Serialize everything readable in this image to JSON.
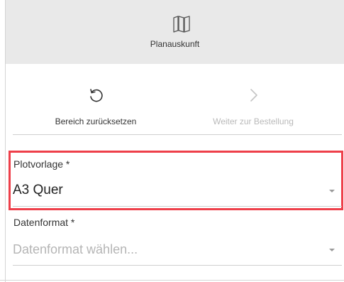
{
  "header": {
    "title": "Planauskunft",
    "icon": "map-icon"
  },
  "actions": {
    "reset": {
      "label": "Bereich zurücksetzen",
      "icon": "reset-icon"
    },
    "next": {
      "label": "Weiter zur Bestellung",
      "icon": "chevron-right-icon",
      "disabled": true
    }
  },
  "form": {
    "plot_template": {
      "label": "Plotvorlage *",
      "value": "A3 Quer"
    },
    "data_format": {
      "label": "Datenformat *",
      "placeholder": "Datenformat wählen..."
    }
  },
  "colors": {
    "highlight": "#ee3f4a",
    "header_bg": "#e9e9e9",
    "disabled_text": "#b9b9b9"
  }
}
